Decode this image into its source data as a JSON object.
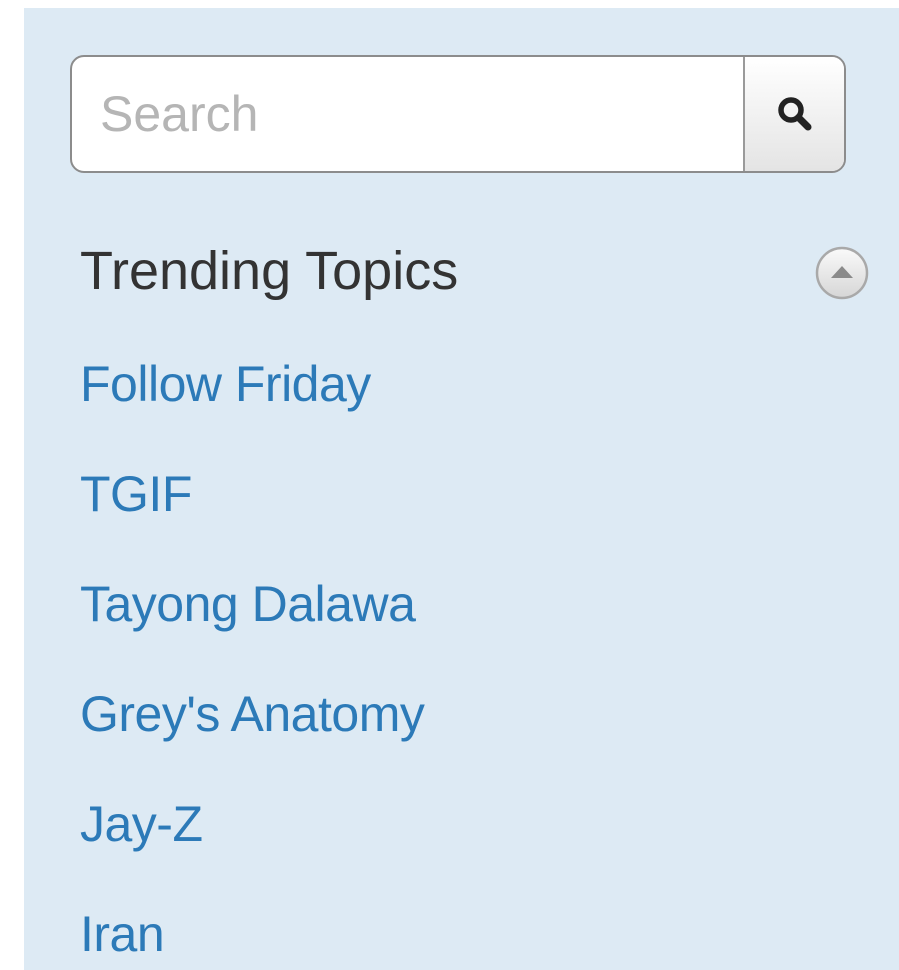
{
  "search": {
    "placeholder": "Search",
    "value": "",
    "button_icon": "search-icon"
  },
  "trending": {
    "title": "Trending Topics",
    "collapse_icon": "collapse-up-icon",
    "topics": [
      {
        "label": "Follow Friday"
      },
      {
        "label": "TGIF"
      },
      {
        "label": "Tayong Dalawa"
      },
      {
        "label": "Grey's Anatomy"
      },
      {
        "label": "Jay-Z"
      },
      {
        "label": "Iran"
      }
    ]
  },
  "colors": {
    "panel_background": "#ddeaf4",
    "link": "#2c7ab8",
    "heading": "#333333",
    "placeholder": "#b5b5b5"
  }
}
